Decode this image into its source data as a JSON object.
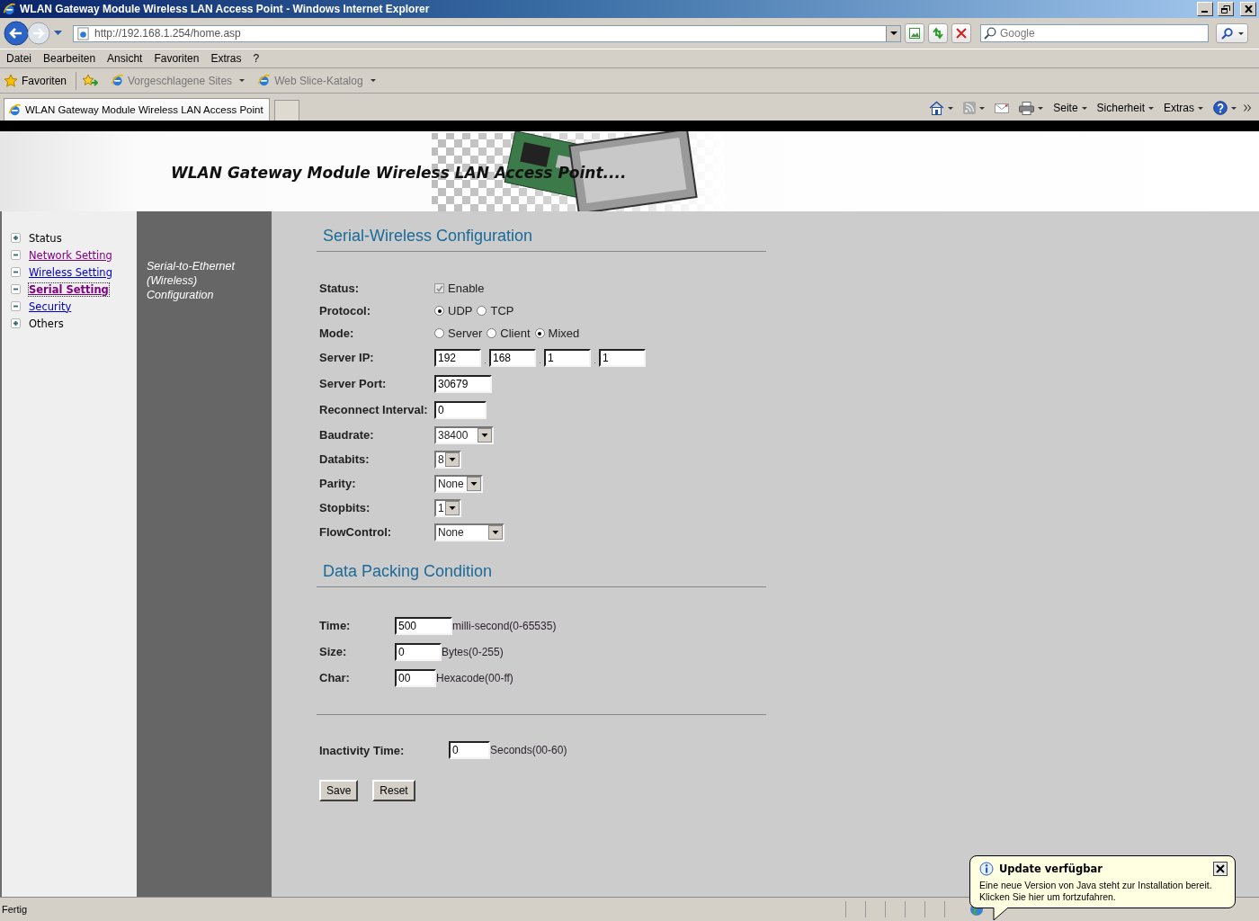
{
  "window": {
    "title": "WLAN Gateway Module Wireless LAN Access Point - Windows Internet Explorer"
  },
  "address_bar": {
    "url": "http://192.168.1.254/home.asp"
  },
  "search": {
    "placeholder": "Google"
  },
  "menu_bar": [
    "Datei",
    "Bearbeiten",
    "Ansicht",
    "Favoriten",
    "Extras",
    "?"
  ],
  "favorites_bar": {
    "favorites": "Favoriten",
    "links": [
      "Vorgeschlagene Sites",
      "Web Slice-Katalog"
    ]
  },
  "tabs": [
    {
      "label": "WLAN Gateway Module Wireless LAN Access Point",
      "selected": true
    }
  ],
  "command_bar": [
    "Seite",
    "Sicherheit",
    "Extras"
  ],
  "banner": {
    "title": "WLAN Gateway Module Wireless LAN Access Point...."
  },
  "sidebar": {
    "items": [
      {
        "label": "Status",
        "kind": "text",
        "expanded": false,
        "selected": false
      },
      {
        "label": "Network Setting",
        "kind": "link",
        "expanded": true,
        "visited": true,
        "selected": false
      },
      {
        "label": "Wireless Setting",
        "kind": "link",
        "expanded": true,
        "visited": false,
        "selected": false
      },
      {
        "label": "Serial Setting",
        "kind": "link",
        "expanded": true,
        "visited": true,
        "selected": true
      },
      {
        "label": "Security",
        "kind": "link",
        "expanded": true,
        "visited": false,
        "selected": false
      },
      {
        "label": "Others",
        "kind": "text",
        "expanded": false,
        "selected": false
      }
    ]
  },
  "side_panel": {
    "caption": "Serial-to-Ethernet (Wireless) Configuration"
  },
  "serial_config": {
    "heading": "Serial-Wireless Configuration",
    "rows": [
      {
        "kind": "checkbox",
        "label": "Status:",
        "option": "Enable",
        "checked": true,
        "disabled": true
      },
      {
        "kind": "radio",
        "label": "Protocol:",
        "options": [
          {
            "label": "UDP",
            "selected": true
          },
          {
            "label": "TCP",
            "selected": false
          }
        ]
      },
      {
        "kind": "radio",
        "label": "Mode:",
        "options": [
          {
            "label": "Server",
            "selected": false
          },
          {
            "label": "Client",
            "selected": false
          },
          {
            "label": "Mixed",
            "selected": true
          }
        ]
      },
      {
        "kind": "ip",
        "label": "Server IP:",
        "values": [
          "192",
          "168",
          "1",
          "1"
        ],
        "separators": [
          ".",
          ".",
          "."
        ]
      },
      {
        "kind": "text",
        "label": "Server Port:",
        "value": "30679"
      },
      {
        "kind": "text",
        "label": "Reconnect Interval:",
        "value": "0"
      },
      {
        "kind": "select",
        "label": "Baudrate:",
        "value": "38400"
      },
      {
        "kind": "select",
        "label": "Databits:",
        "value": "8"
      },
      {
        "kind": "select",
        "label": "Parity:",
        "value": "None"
      },
      {
        "kind": "select",
        "label": "Stopbits:",
        "value": "1"
      },
      {
        "kind": "select",
        "label": "FlowControl:",
        "value": "None"
      }
    ]
  },
  "packing": {
    "heading": "Data Packing Condition",
    "rows": [
      {
        "label": "Time:",
        "value": "500",
        "unit": "milli-second(0-65535)"
      },
      {
        "label": "Size:",
        "value": "0",
        "unit": "Bytes(0-255)"
      },
      {
        "label": "Char:",
        "value": "00",
        "unit": "Hexacode(00-ff)"
      }
    ]
  },
  "inactivity": {
    "label": "Inactivity Time:",
    "value": "0",
    "unit": "Seconds(00-60)"
  },
  "buttons": [
    "Save",
    "Reset"
  ],
  "status_bar": {
    "text": "Fertig"
  },
  "notification": {
    "title": "Update verfügbar",
    "message": "Eine neue Version von Java steht zur Installation bereit. Klicken Sie hier um fortzufahren."
  }
}
